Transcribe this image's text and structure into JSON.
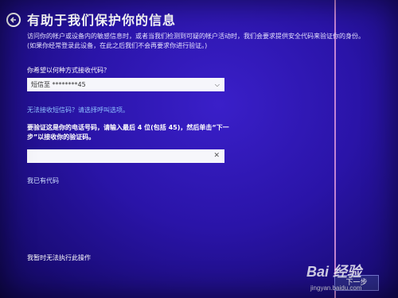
{
  "header": {
    "title": "有助于我们保护你的信息"
  },
  "description": "访问你的帐户或设备内的敏感信息时，或者当我们检测到可疑的帐户活动时，我们会要求提供安全代码来验证你的身份。(如果你经常登录此设备，在此之后我们不会再要求你进行验证。)",
  "method": {
    "label": "你希望以何种方式接收代码？",
    "selected": "短信至 ********45"
  },
  "links": {
    "no_sms": "无法接收短信码？请选择呼叫选项。",
    "have_code": "我已有代码",
    "cant_do": "我暂时无法执行此操作"
  },
  "verify": {
    "hint": "要验证这是你的电话号码，请输入最后 4 位(包括 45)，然后单击“下一步”以接收你的验证码。",
    "input_value": ""
  },
  "buttons": {
    "next": "下一步"
  },
  "watermark": {
    "logo": "Bai 经验",
    "sub": "jingyan.baidu.com"
  }
}
